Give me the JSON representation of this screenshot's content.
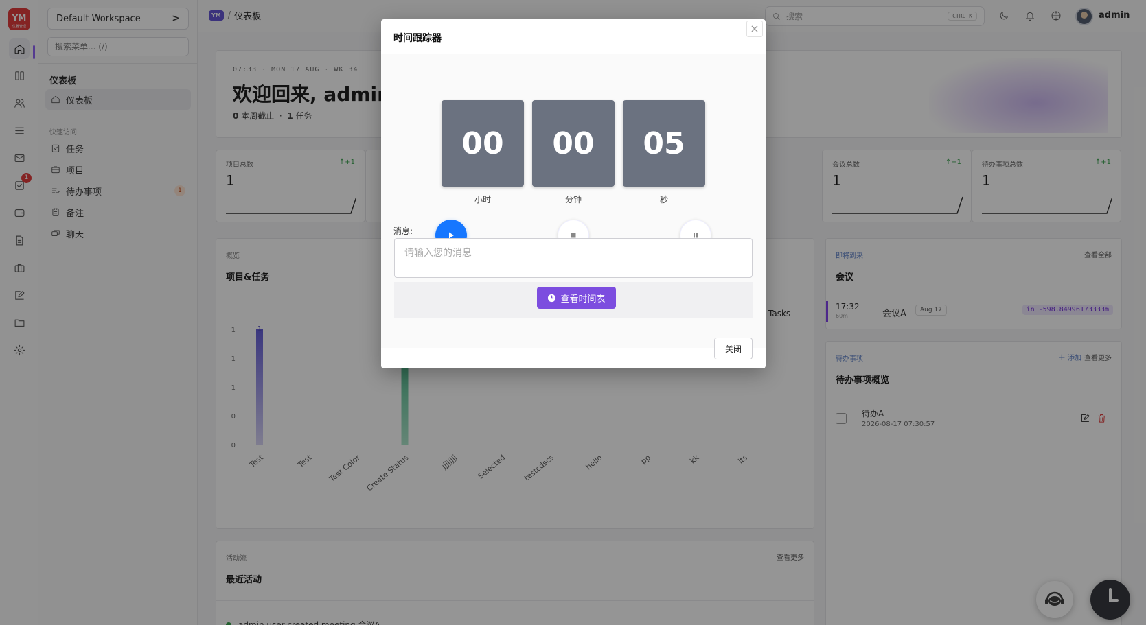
{
  "rail": {
    "logo_text": "YM",
    "logo_caption": "优雅管理",
    "todo_badge": "1"
  },
  "sidebar": {
    "workspace": "Default Workspace",
    "search_placeholder": "搜索菜单... (/)",
    "section_title": "仪表板",
    "dashboard_item": "仪表板",
    "quick_access_label": "快速访问",
    "items": [
      {
        "label": "任务",
        "icon": "task-icon"
      },
      {
        "label": "项目",
        "icon": "briefcase-icon"
      },
      {
        "label": "待办事项",
        "icon": "list-check-icon",
        "count": "1"
      },
      {
        "label": "备注",
        "icon": "note-icon"
      },
      {
        "label": "聊天",
        "icon": "chat-icon"
      }
    ]
  },
  "topbar": {
    "workspace_badge": "YM",
    "breadcrumb_sep": "/",
    "breadcrumb": "仪表板",
    "search_placeholder": "搜索",
    "search_shortcut": "CTRL K",
    "username": "admin"
  },
  "hero": {
    "date_line": "07:33 · MON 17 AUG · WK 34",
    "welcome": "欢迎回来, admin.",
    "due_count": "0",
    "due_label": "本周截止",
    "dot": "·",
    "task_count": "1",
    "task_label": "任务"
  },
  "stats": [
    {
      "label": "项目总数",
      "delta": "↑+1",
      "value": "1"
    },
    {
      "label": "会议总数",
      "delta": "↑+1",
      "value": "1"
    },
    {
      "label": "待办事项总数",
      "delta": "↑+1",
      "value": "1"
    }
  ],
  "overview": {
    "subtitle": "概览",
    "title": "项目&任务",
    "legend_tasks": "Tasks"
  },
  "chart_data": {
    "type": "bar",
    "categories": [
      "Test",
      "Test",
      "Test Color",
      "Create Status",
      "jjjjjjjj",
      "Selected",
      "testcdscs",
      "hello",
      "pp",
      "kk",
      "its"
    ],
    "y_tick_labels": [
      "0",
      "0",
      "1",
      "1",
      "1"
    ],
    "ylim": [
      0,
      1
    ],
    "series": [
      {
        "name": "Tasks",
        "values": [
          0,
          0,
          0,
          1,
          0,
          0,
          0,
          0,
          0,
          0,
          0
        ],
        "color": "#2fb67c"
      },
      {
        "values": [
          1,
          0,
          0,
          0,
          0,
          0,
          0,
          0,
          0,
          0,
          0
        ],
        "color": "#6b66d9",
        "data_labels": [
          "1",
          "",
          "",
          "",
          "",
          "",
          "",
          "",
          "",
          "",
          ""
        ]
      }
    ]
  },
  "activity": {
    "subtitle": "活动流",
    "view_more": "查看更多",
    "title": "最近活动",
    "item": "admin user created meeting 会议A"
  },
  "meetings": {
    "subtitle": "即将到来",
    "view_all": "查看全部",
    "title": "会议",
    "row": {
      "time": "17:32",
      "duration": "60m",
      "name": "会议A",
      "date": "Aug 17",
      "countdown": "in -598.84996173333m"
    }
  },
  "todos": {
    "subtitle": "待办事项",
    "add": "添加",
    "view_more": "查看更多",
    "title": "待办事项概览",
    "row": {
      "name": "待办A",
      "datetime": "2026-08-17 07:30:57"
    }
  },
  "modal": {
    "title": "时间跟踪器",
    "hours": "00",
    "minutes": "00",
    "seconds": "05",
    "hours_label": "小时",
    "minutes_label": "分钟",
    "seconds_label": "秒",
    "message_label": "消息:",
    "message_placeholder": "请输入您的消息",
    "view_timesheet": "查看时间表",
    "close": "关闭",
    "close_x": "×"
  },
  "colors": {
    "accent": "#7c4ddf",
    "play": "#1677ff",
    "tile": "#6b7280",
    "success": "#2f9e44",
    "danger": "#e03131"
  }
}
